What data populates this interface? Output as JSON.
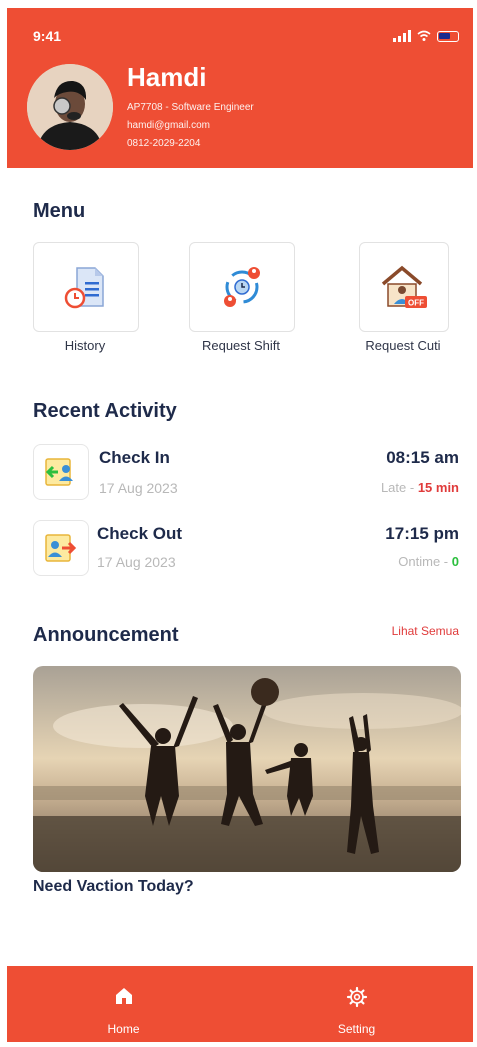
{
  "status_bar": {
    "time": "9:41"
  },
  "profile": {
    "name": "Hamdi",
    "role": "AP7708 - Software Engineer",
    "email": "hamdi@gmail.com",
    "phone": "0812-2029-2204"
  },
  "menu": {
    "title": "Menu",
    "items": [
      {
        "label": "History",
        "icon": "history-icon"
      },
      {
        "label": "Request Shift",
        "icon": "shift-swap-icon"
      },
      {
        "label": "Request Cuti",
        "icon": "leave-home-icon"
      }
    ]
  },
  "recent_activity": {
    "title": "Recent Activity",
    "items": [
      {
        "title": "Check In",
        "date": "17 Aug 2023",
        "time": "08:15 am",
        "status_label": "Late - ",
        "status_value": "15 min"
      },
      {
        "title": "Check Out",
        "date": "17 Aug 2023",
        "time": "17:15 pm",
        "status_label": "Ontime - ",
        "status_value": "0"
      }
    ]
  },
  "announcement": {
    "title": "Announcement",
    "see_all": "Lihat Semua",
    "banner_title": "Need Vaction Today?"
  },
  "tabbar": {
    "items": [
      {
        "label": "Home",
        "icon": "home-icon"
      },
      {
        "label": "Setting",
        "icon": "gear-icon"
      }
    ]
  },
  "colors": {
    "brand": "#ee4e34",
    "late": "#e03b3b",
    "ontime": "#2cbf3e",
    "text": "#1e2a4a"
  }
}
